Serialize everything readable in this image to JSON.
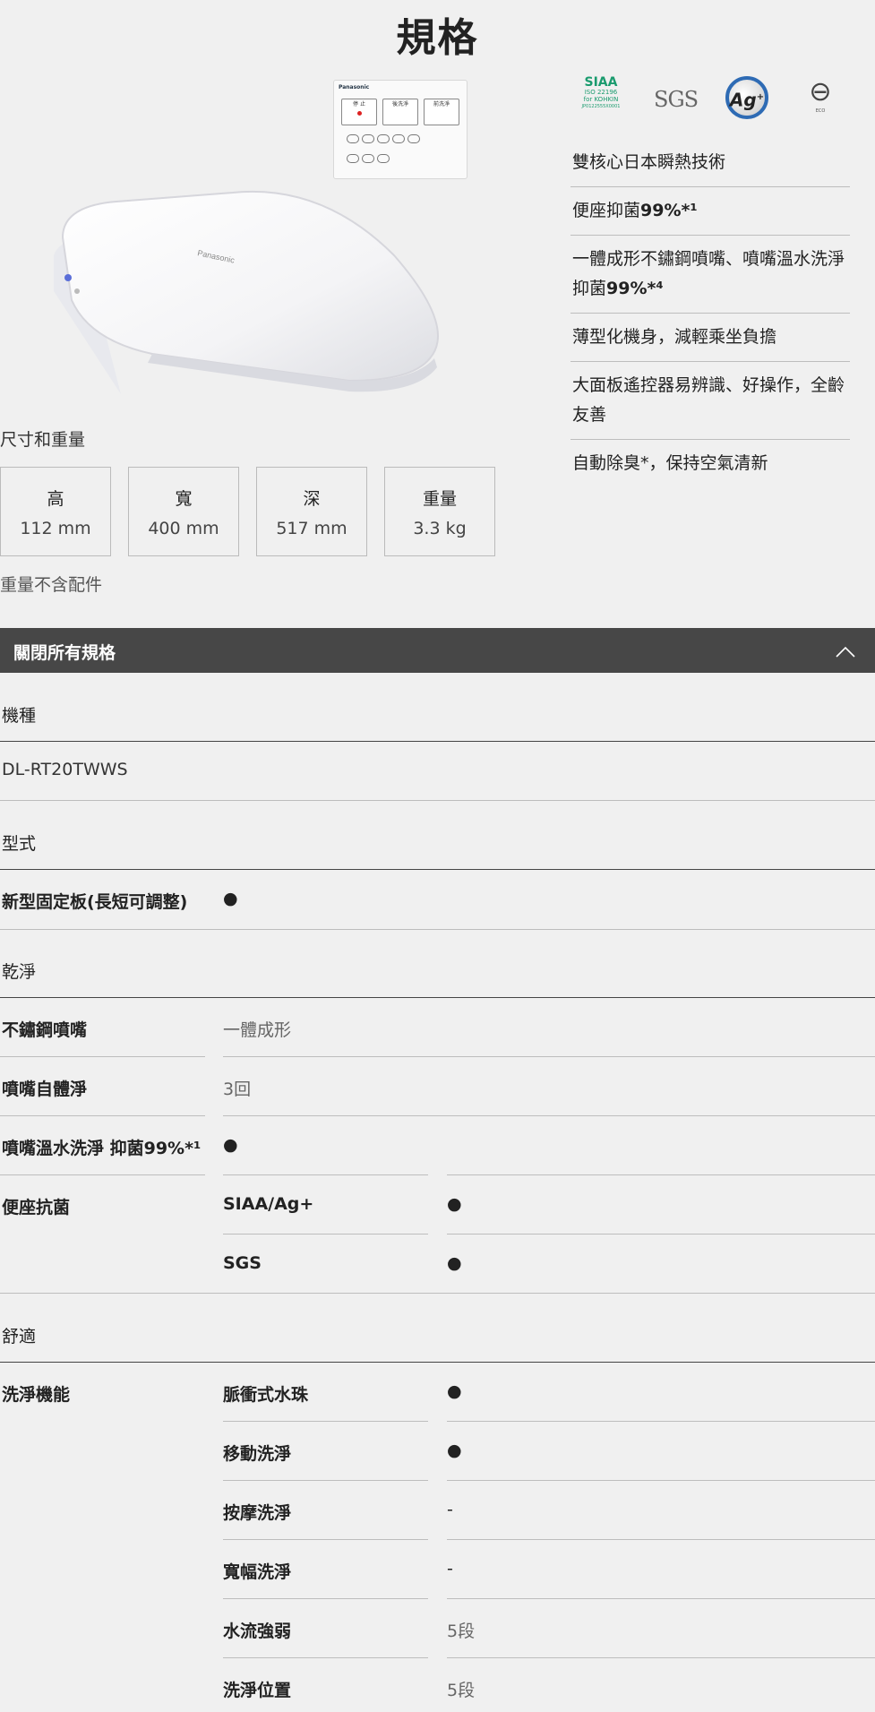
{
  "page_title": "規格",
  "remote": {
    "brand": "Panasonic",
    "buttons": [
      "停 止",
      "後洗淨",
      "前洗淨"
    ]
  },
  "certifications": {
    "siaa": {
      "main": "SIAA",
      "line1": "ISO 22196",
      "line2": "for KOHKIN",
      "line3": "JP0122555X0001"
    },
    "sgs": "SGS",
    "ag": {
      "main": "Ag",
      "sup": "+"
    },
    "symbol_caption": "ECO"
  },
  "features": [
    {
      "text": "雙核心日本瞬熱技術",
      "bold": ""
    },
    {
      "text": "便座抑菌",
      "bold": "99%*¹"
    },
    {
      "text": "一體成形不鏽鋼噴嘴、噴嘴溫水洗淨 抑菌",
      "bold": "99%*⁴"
    },
    {
      "text": "薄型化機身，減輕乘坐負擔",
      "bold": ""
    },
    {
      "text": "大面板遙控器易辨識、好操作，全齡友善",
      "bold": ""
    },
    {
      "text": "自動除臭*，保持空氣清新",
      "bold": ""
    }
  ],
  "dimensions": {
    "title": "尺寸和重量",
    "items": [
      {
        "label": "高",
        "value": "112 mm"
      },
      {
        "label": "寬",
        "value": "400 mm"
      },
      {
        "label": "深",
        "value": "517 mm"
      },
      {
        "label": "重量",
        "value": "3.3 kg"
      }
    ],
    "note": "重量不含配件"
  },
  "collapse_label": "關閉所有規格",
  "specs": {
    "model_section": "機種",
    "model_value": "DL-RT20TWWS",
    "type_section": "型式",
    "type_label": "新型固定板(長短可調整)",
    "type_value": "●",
    "clean_section": "乾淨",
    "nozzle_label": "不鏽鋼噴嘴",
    "nozzle_value": "一體成形",
    "selfclean_label": "噴嘴自體淨",
    "selfclean_value": "3回",
    "warm_label": "噴嘴溫水洗淨 抑菌99%*¹",
    "warm_value": "●",
    "antibac_label": "便座抗菌",
    "antibac_sub1": "SIAA/Ag+",
    "antibac_val1": "●",
    "antibac_sub2": "SGS",
    "antibac_val2": "●",
    "comfort_section": "舒適",
    "wash_label": "洗淨機能",
    "wash_items": [
      {
        "name": "脈衝式水珠",
        "value": "●"
      },
      {
        "name": "移動洗淨",
        "value": "●"
      },
      {
        "name": "按摩洗淨",
        "value": "-"
      },
      {
        "name": "寬幅洗淨",
        "value": "-"
      },
      {
        "name": "水流強弱",
        "value": "5段"
      },
      {
        "name": "洗淨位置",
        "value": "5段"
      }
    ]
  }
}
